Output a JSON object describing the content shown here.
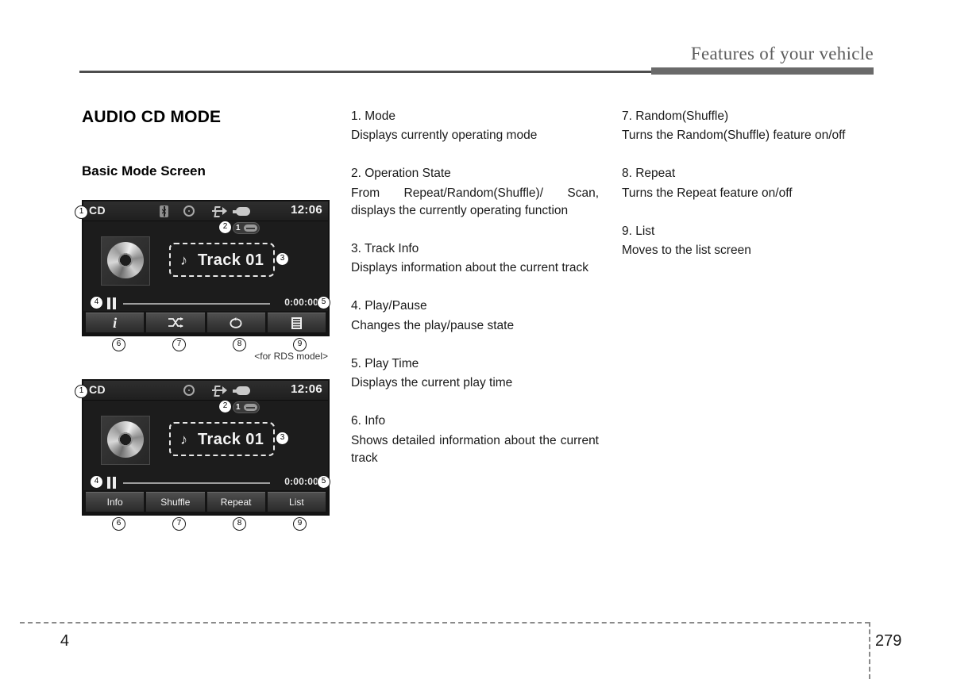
{
  "header": {
    "title": "Features of your vehicle"
  },
  "left": {
    "section_title": "AUDIO CD MODE",
    "sub_title": "Basic Mode Screen",
    "caption_rds": "<for RDS model>"
  },
  "screens": [
    {
      "id": "screen-icon-buttons",
      "mode": "CD",
      "time": "12:06",
      "status_icons": [
        "bluetooth-icon",
        "disc-icon",
        "usb-icon",
        "plug-icon"
      ],
      "op_state_number": "1",
      "track_name": "Track 01",
      "play_time": "0:00:00",
      "buttons": [
        {
          "name": "info-button",
          "icon": "info-icon",
          "label": ""
        },
        {
          "name": "shuffle-button",
          "icon": "shuffle-icon",
          "label": ""
        },
        {
          "name": "repeat-button",
          "icon": "repeat-icon",
          "label": ""
        },
        {
          "name": "list-button",
          "icon": "list-icon",
          "label": ""
        }
      ],
      "callouts": [
        "1",
        "2",
        "3",
        "4",
        "5",
        "6",
        "7",
        "8",
        "9"
      ]
    },
    {
      "id": "screen-text-buttons",
      "mode": "CD",
      "time": "12:06",
      "status_icons": [
        "disc-icon",
        "usb-icon",
        "plug-icon"
      ],
      "op_state_number": "1",
      "track_name": "Track 01",
      "play_time": "0:00:00",
      "buttons": [
        {
          "name": "info-button",
          "icon": "",
          "label": "Info"
        },
        {
          "name": "shuffle-button",
          "icon": "",
          "label": "Shuffle"
        },
        {
          "name": "repeat-button",
          "icon": "",
          "label": "Repeat"
        },
        {
          "name": "list-button",
          "icon": "",
          "label": "List"
        }
      ],
      "callouts": [
        "1",
        "2",
        "3",
        "4",
        "5",
        "6",
        "7",
        "8",
        "9"
      ]
    }
  ],
  "middle_entries": [
    {
      "title": "1. Mode",
      "desc": "Displays currently operating mode",
      "justify": false
    },
    {
      "title": "2. Operation State",
      "desc": "From Repeat/Random(Shuffle)/ Scan, displays the currently operating function",
      "justify": true
    },
    {
      "title": "3. Track Info",
      "desc": "Displays information about the current track",
      "justify": true
    },
    {
      "title": "4. Play/Pause",
      "desc": "Changes the play/pause state",
      "justify": false
    },
    {
      "title": "5. Play Time",
      "desc": "Displays the current play time",
      "justify": false
    },
    {
      "title": "6. Info",
      "desc": "Shows detailed information about the current track",
      "justify": true
    }
  ],
  "right_entries": [
    {
      "title": "7. Random(Shuffle)",
      "desc": "Turns the Random(Shuffle) feature on/off",
      "justify": true
    },
    {
      "title": "8. Repeat",
      "desc": "Turns the Repeat feature on/off",
      "justify": false
    },
    {
      "title": "9. List",
      "desc": "Moves to the list screen",
      "justify": false
    }
  ],
  "footer": {
    "chapter": "4",
    "page": "279"
  },
  "colors": {
    "header_rule": "#4d4d4d",
    "header_text": "#5c5c5c",
    "screen_bg": "#1c1c1c",
    "text": "#1a1a1a"
  }
}
